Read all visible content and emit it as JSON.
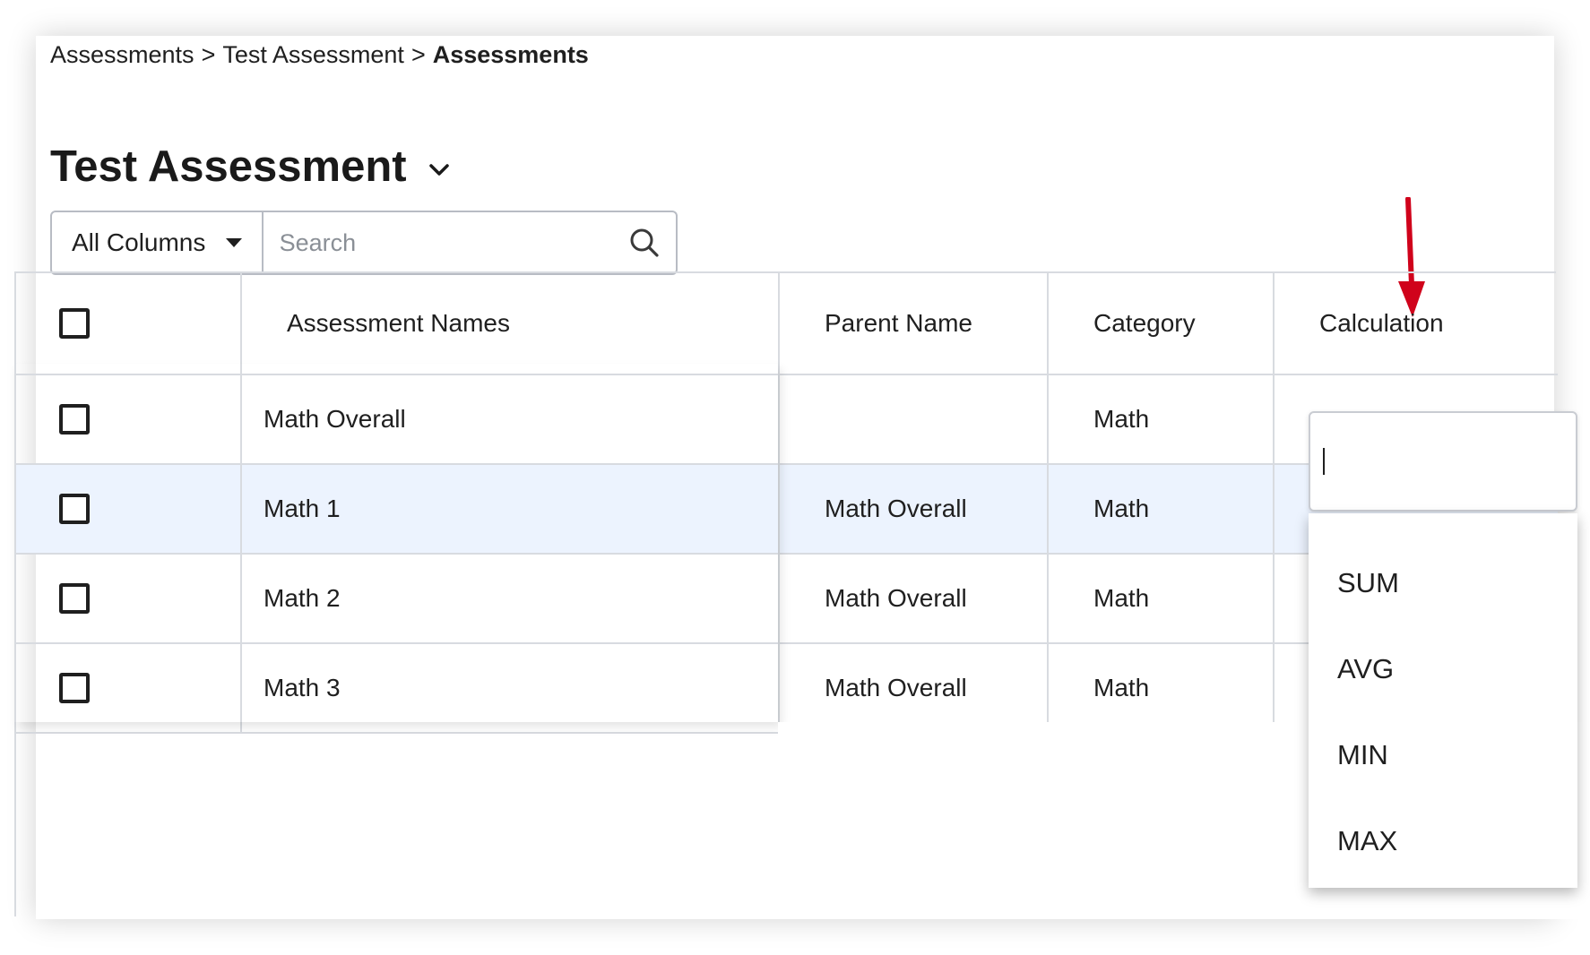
{
  "breadcrumb": {
    "items": [
      "Assessments",
      "Test Assessment"
    ],
    "current": "Assessments",
    "separator": ">"
  },
  "page": {
    "title": "Test Assessment"
  },
  "search": {
    "column_filter": "All Columns",
    "placeholder": "Search",
    "value": ""
  },
  "table": {
    "headers": {
      "name": "Assessment Names",
      "parent": "Parent Name",
      "category": "Category",
      "calculation": "Calculation"
    },
    "rows": [
      {
        "name": "Math Overall",
        "parent": "",
        "category": "Math",
        "selected": false
      },
      {
        "name": "Math 1",
        "parent": "Math Overall",
        "category": "Math",
        "selected": true
      },
      {
        "name": "Math 2",
        "parent": "Math Overall",
        "category": "Math",
        "selected": false
      },
      {
        "name": "Math 3",
        "parent": "Math Overall",
        "category": "Math",
        "selected": false
      }
    ]
  },
  "calculation_dropdown": {
    "value": "",
    "options": [
      "SUM",
      "AVG",
      "MIN",
      "MAX"
    ]
  },
  "colors": {
    "selected_row": "#ecf3fe",
    "grid_line": "#d8dbe0",
    "annotation_arrow": "#d0021b"
  },
  "icons": {
    "title_toggle": "chevron-down-icon",
    "column_filter": "caret-down-icon",
    "search": "search-icon",
    "annotation": "arrow-down-icon"
  }
}
